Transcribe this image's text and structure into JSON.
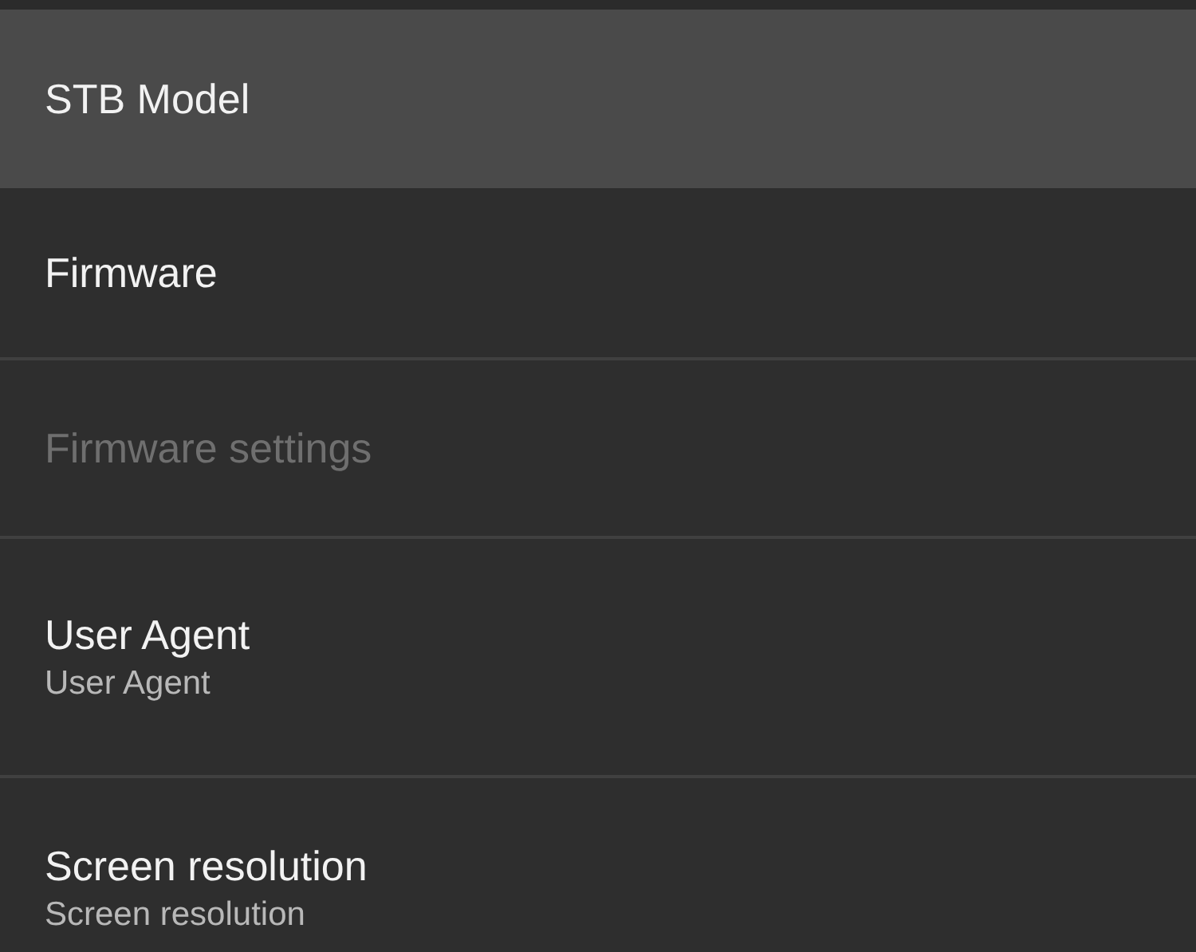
{
  "items": [
    {
      "title": "STB Model",
      "selected": true,
      "disabled": false
    },
    {
      "title": "Firmware",
      "selected": false,
      "disabled": false
    },
    {
      "title": "Firmware settings",
      "selected": false,
      "disabled": true
    },
    {
      "title": "User Agent",
      "subtitle": "User Agent",
      "selected": false,
      "disabled": false
    },
    {
      "title": "Screen resolution",
      "subtitle": "Screen resolution",
      "selected": false,
      "disabled": false
    }
  ]
}
